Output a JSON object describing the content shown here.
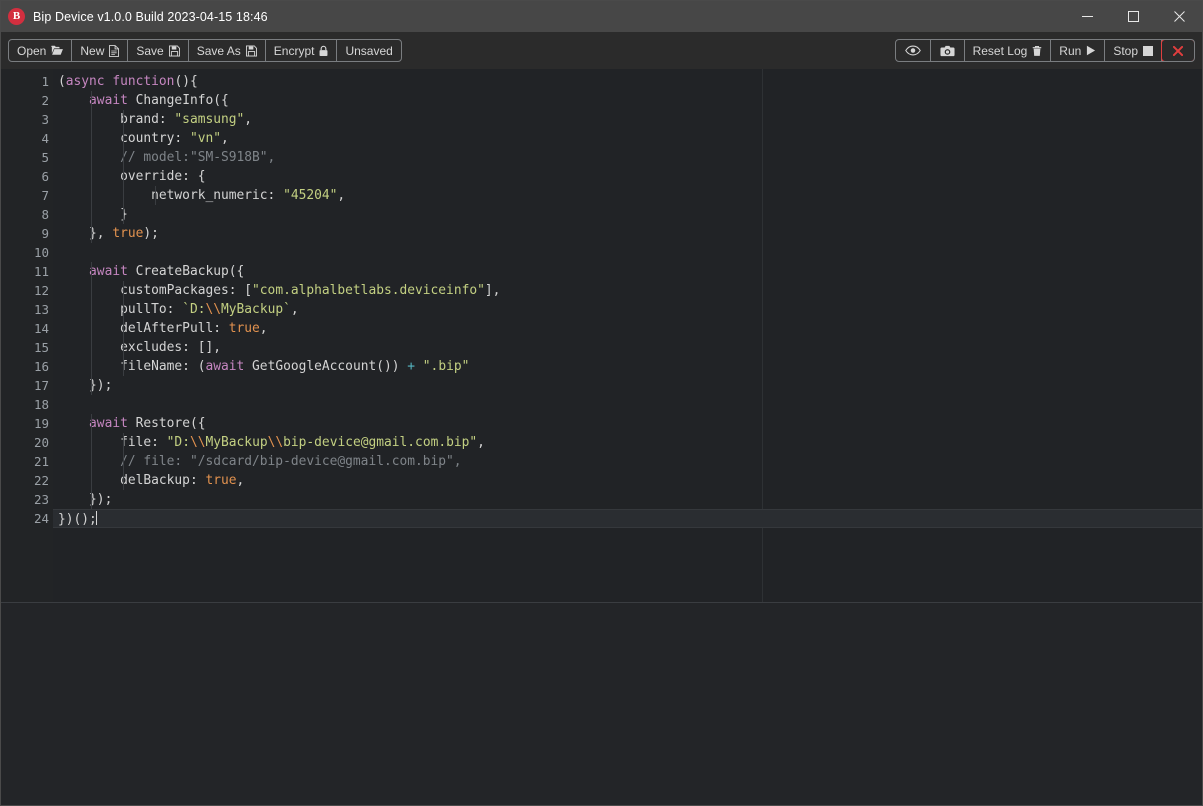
{
  "window": {
    "title": "Bip Device v1.0.0 Build 2023-04-15 18:46",
    "icon_letter": "B",
    "icon_name": "bip-app-icon",
    "accent_red": "#d32f3f",
    "titlebar_bg": "#474747",
    "controls": {
      "minimize": "minimize-icon",
      "maximize": "maximize-icon",
      "close": "close-icon"
    }
  },
  "toolbar": {
    "left_buttons": [
      {
        "label": "Open",
        "icon": "folder-open-icon"
      },
      {
        "label": "New",
        "icon": "file-icon"
      },
      {
        "label": "Save",
        "icon": "floppy-disk-icon"
      },
      {
        "label": "Save As",
        "icon": "floppy-disk-icon"
      },
      {
        "label": "Encrypt",
        "icon": "lock-icon"
      },
      {
        "label": "Unsaved",
        "icon": ""
      }
    ],
    "right_buttons": [
      {
        "label": "",
        "icon": "eye-icon"
      },
      {
        "label": "",
        "icon": "camera-icon"
      },
      {
        "label": "Reset Log",
        "icon": "trash-icon"
      },
      {
        "label": "Run",
        "icon": "play-icon"
      },
      {
        "label": "Stop",
        "icon": "stop-icon"
      },
      {
        "label": "",
        "icon": "close-x-icon",
        "danger": true,
        "color": "#e03e3e"
      }
    ]
  },
  "editor": {
    "language": "javascript",
    "cursor_line": 24,
    "cursor_column": 6,
    "total_lines": 24,
    "fold_lines": [
      1,
      2,
      6,
      11,
      19
    ],
    "theme": {
      "background": "#212326",
      "gutter_background": "#222426",
      "line_number": "#9aa0a6",
      "text": "#d4d4d4",
      "keyword": "#c586c0",
      "string": "#c3d082",
      "comment": "#7f8489",
      "boolean": "#e2924f",
      "operator": "#56b6c2",
      "active_line": "#2a2d31"
    },
    "lines": [
      {
        "n": 1,
        "text": "(async function(){"
      },
      {
        "n": 2,
        "text": "    await ChangeInfo({"
      },
      {
        "n": 3,
        "text": "        brand: \"samsung\","
      },
      {
        "n": 4,
        "text": "        country: \"vn\","
      },
      {
        "n": 5,
        "text": "        // model:\"SM-S918B\","
      },
      {
        "n": 6,
        "text": "        override: {"
      },
      {
        "n": 7,
        "text": "            network_numeric: \"45204\","
      },
      {
        "n": 8,
        "text": "        }"
      },
      {
        "n": 9,
        "text": "    }, true);"
      },
      {
        "n": 10,
        "text": ""
      },
      {
        "n": 11,
        "text": "    await CreateBackup({"
      },
      {
        "n": 12,
        "text": "        customPackages: [\"com.alphalbetlabs.deviceinfo\"],"
      },
      {
        "n": 13,
        "text": "        pullTo: `D:\\\\MyBackup`,"
      },
      {
        "n": 14,
        "text": "        delAfterPull: true,"
      },
      {
        "n": 15,
        "text": "        excludes: [],"
      },
      {
        "n": 16,
        "text": "        fileName: (await GetGoogleAccount()) + \".bip\""
      },
      {
        "n": 17,
        "text": "    });"
      },
      {
        "n": 18,
        "text": ""
      },
      {
        "n": 19,
        "text": "    await Restore({"
      },
      {
        "n": 20,
        "text": "        file: \"D:\\\\MyBackup\\\\bip-device@gmail.com.bip\","
      },
      {
        "n": 21,
        "text": "        // file: \"/sdcard/bip-device@gmail.com.bip\","
      },
      {
        "n": 22,
        "text": "        delBackup: true,"
      },
      {
        "n": 23,
        "text": "    });"
      },
      {
        "n": 24,
        "text": "})();"
      }
    ]
  },
  "log": {
    "content": "",
    "background": "#232528"
  }
}
